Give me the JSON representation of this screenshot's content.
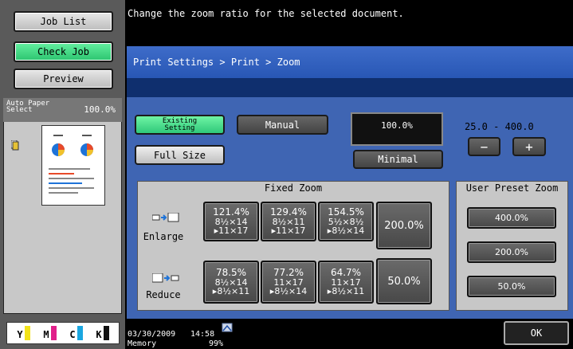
{
  "left_nav": {
    "job_list": "Job List",
    "check_job": "Check Job",
    "preview": "Preview"
  },
  "preview": {
    "paper_label_1": "Auto Paper",
    "paper_label_2": "Select",
    "zoom": "100.0%"
  },
  "toner": [
    {
      "letter": "Y",
      "color": "#f2e21a"
    },
    {
      "letter": "M",
      "color": "#e0208a"
    },
    {
      "letter": "C",
      "color": "#19a6e0"
    },
    {
      "letter": "K",
      "color": "#111111"
    }
  ],
  "message": "Change the zoom ratio for the selected document.",
  "breadcrumb": "Print Settings > Print > Zoom",
  "controls": {
    "existing_setting_1": "Existing",
    "existing_setting_2": "Setting",
    "manual": "Manual",
    "full_size": "Full Size",
    "current_zoom": "100.0%",
    "minimal": "Minimal",
    "range": "25.0  -  400.0",
    "minus": "−",
    "plus": "+"
  },
  "fixed_zoom": {
    "title": "Fixed Zoom",
    "enlarge_label": "Enlarge",
    "reduce_label": "Reduce",
    "enlarge": [
      {
        "pct": "121.4%",
        "l1": "8½×14",
        "l2": "▸11×17"
      },
      {
        "pct": "129.4%",
        "l1": "8½×11",
        "l2": "▸11×17"
      },
      {
        "pct": "154.5%",
        "l1": "5½×8½",
        "l2": "▸8½×14"
      }
    ],
    "enlarge_max": "200.0%",
    "reduce": [
      {
        "pct": "78.5%",
        "l1": "8½×14",
        "l2": "▸8½×11"
      },
      {
        "pct": "77.2%",
        "l1": "11×17",
        "l2": "▸8½×14"
      },
      {
        "pct": "64.7%",
        "l1": "11×17",
        "l2": "▸8½×11"
      }
    ],
    "reduce_min": "50.0%"
  },
  "user_preset": {
    "title": "User Preset Zoom",
    "presets": [
      "400.0%",
      "200.0%",
      "50.0%"
    ]
  },
  "footer": {
    "date": "03/30/2009",
    "time": "14:58",
    "memory_label": "Memory",
    "memory_value": "99%",
    "ok": "OK"
  }
}
